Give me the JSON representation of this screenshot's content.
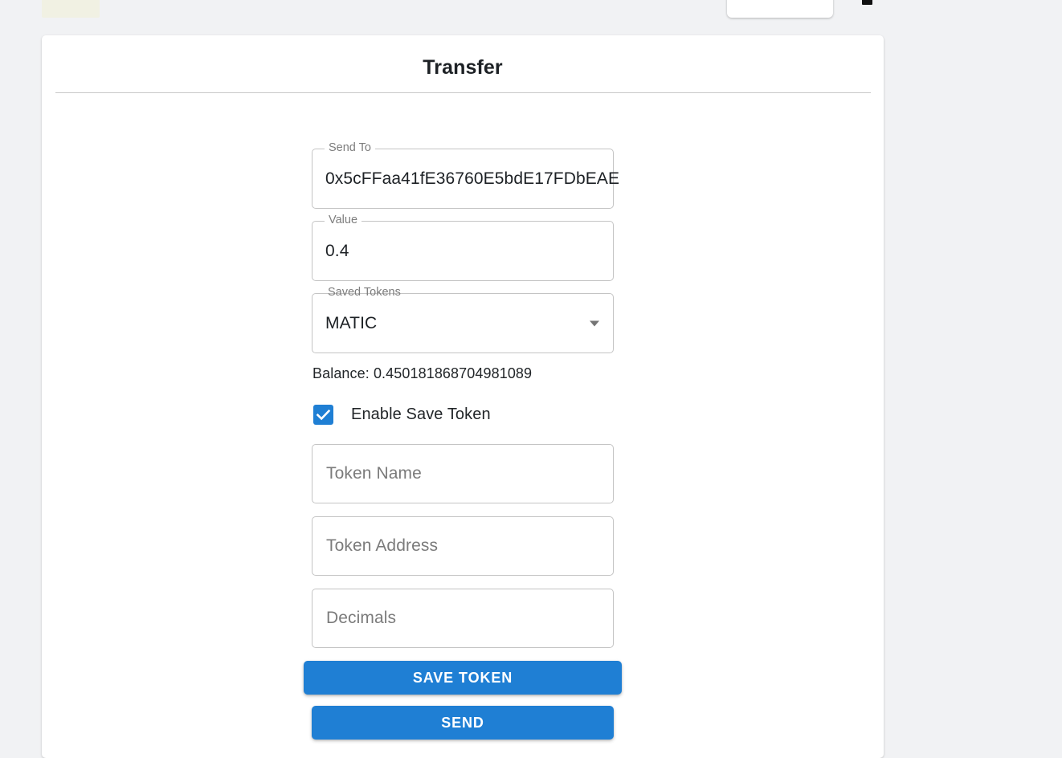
{
  "page": {
    "background_color": "#f1f2f4",
    "accent_color": "#1f7fd4"
  },
  "top_fragments": {
    "left_badge_color": "#f1f1e3",
    "card_color": "#ffffff",
    "icon_name": "cut-off-dark-icon"
  },
  "card": {
    "title": "Transfer"
  },
  "form": {
    "send_to": {
      "label": "Send To",
      "value": "0x5cFFaa41fE36760E5bdE17FDbEAE"
    },
    "value_field": {
      "label": "Value",
      "value": "0.4"
    },
    "saved_tokens": {
      "label": "Saved Tokens",
      "selected": "MATIC",
      "options": [
        "MATIC"
      ]
    },
    "balance": "Balance: 0.450181868704981089",
    "enable_save_token": {
      "label": "Enable Save Token",
      "checked": true
    },
    "token_name": {
      "placeholder": "Token Name",
      "value": ""
    },
    "token_address": {
      "placeholder": "Token Address",
      "value": ""
    },
    "decimals": {
      "placeholder": "Decimals",
      "value": ""
    }
  },
  "buttons": {
    "save_token": "SAVE TOKEN",
    "send": "SEND"
  }
}
